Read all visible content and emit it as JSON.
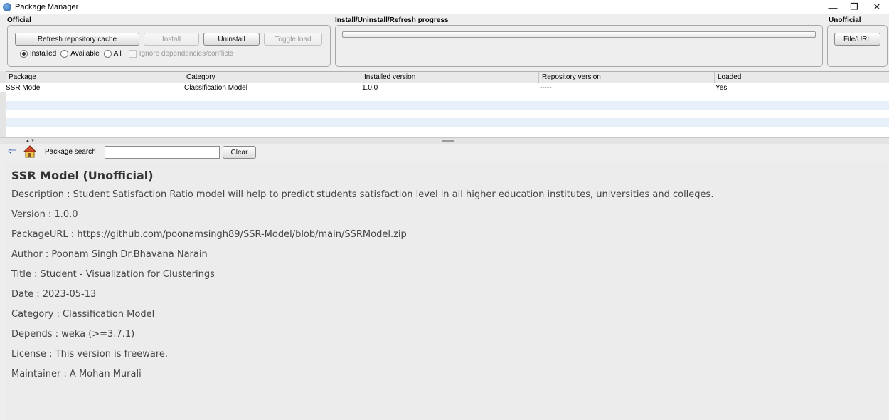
{
  "window": {
    "title": "Package Manager",
    "minimize": "—",
    "maximize": "❐",
    "close": "✕"
  },
  "official": {
    "label": "Official",
    "refresh_label": "Refresh repository cache",
    "install_label": "Install",
    "uninstall_label": "Uninstall",
    "toggle_label": "Toggle load",
    "radios": {
      "installed": "Installed",
      "available": "Available",
      "all": "All",
      "selected": "Installed"
    },
    "ignore_label": "Ignore dependencies/conflicts"
  },
  "progress": {
    "label": "Install/Uninstall/Refresh progress",
    "value": 0
  },
  "unofficial": {
    "label": "Unofficial",
    "file_url_label": "File/URL"
  },
  "table": {
    "headers": [
      "Package",
      "Category",
      "Installed version",
      "Repository version",
      "Loaded"
    ],
    "rows": [
      {
        "package": "SSR Model",
        "category": "Classification Model",
        "installed": "1.0.0",
        "repository": "-----",
        "loaded": "Yes"
      }
    ]
  },
  "search": {
    "label": "Package search",
    "value": "",
    "clear_label": "Clear"
  },
  "info": {
    "title": "SSR Model (Unofficial)",
    "lines": [
      "Description : Student Satisfaction Ratio model will help to predict students satisfaction level in all higher education institutes, universities and colleges.",
      "Version : 1.0.0",
      "PackageURL : https://github.com/poonamsingh89/SSR-Model/blob/main/SSRModel.zip",
      "Author : Poonam Singh  Dr.Bhavana Narain",
      "Title : Student - Visualization for Clusterings",
      "Date : 2023-05-13",
      "Category : Classification Model",
      "Depends : weka (>=3.7.1)",
      "License : This version is freeware.",
      "Maintainer : A Mohan Murali"
    ]
  }
}
